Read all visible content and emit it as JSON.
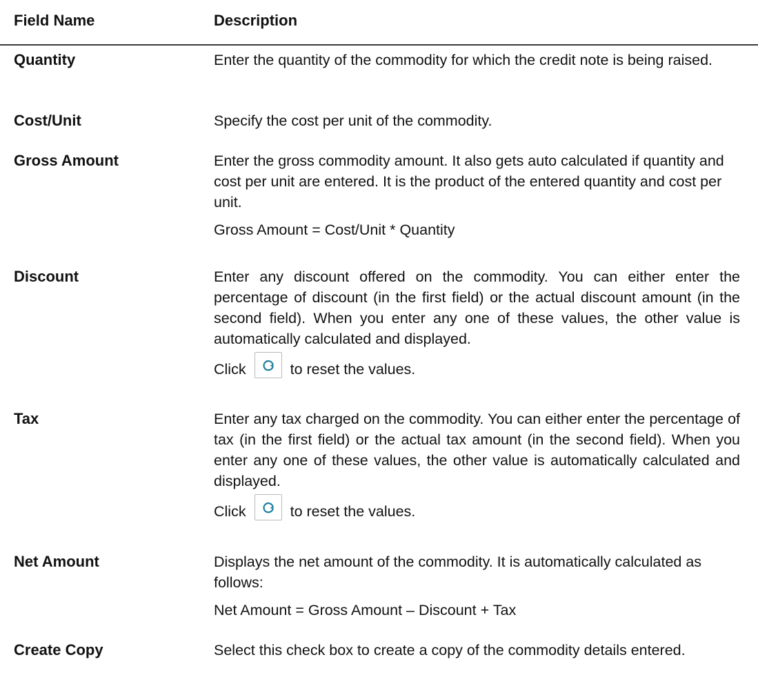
{
  "header": {
    "field_name": "Field Name",
    "description": "Description"
  },
  "rows": [
    {
      "name": "Quantity",
      "desc": [
        "Enter the quantity of the commodity for which the credit note is being raised."
      ]
    },
    {
      "name": "Cost/Unit",
      "desc": [
        "Specify the cost per unit of the commodity."
      ]
    },
    {
      "name": "Gross Amount",
      "desc": [
        "Enter the gross commodity amount. It also gets auto calculated if quantity and cost per unit are entered. It is the product of the entered quantity and cost per unit.",
        "Gross Amount = Cost/Unit * Quantity"
      ]
    },
    {
      "name": "Discount",
      "desc": [
        "Enter any discount offered on the commodity. You can either enter the percentage of discount (in the first field) or the actual discount amount (in the second field). When you enter any one of these values, the other value is automatically calculated and displayed."
      ],
      "click_before": "Click",
      "click_after": "to reset the values."
    },
    {
      "name": "Tax",
      "desc": [
        "Enter any tax charged on the commodity. You can either enter the percentage of tax (in the first field) or the actual tax amount (in the second field). When you enter any one of these values, the other value is automatically calculated and displayed."
      ],
      "click_before": "Click",
      "click_after": "to reset the values."
    },
    {
      "name": "Net Amount",
      "desc": [
        "Displays the net amount of the commodity. It is automatically calculated as follows:",
        "Net Amount = Gross Amount – Discount + Tax"
      ]
    },
    {
      "name": "Create Copy",
      "desc": [
        "Select this check box to create a copy of the commodity details entered."
      ]
    }
  ],
  "icons": {
    "reset": "refresh-icon"
  },
  "colors": {
    "reset_icon": "#1a7fa0",
    "rule": "#3a3a3a"
  }
}
